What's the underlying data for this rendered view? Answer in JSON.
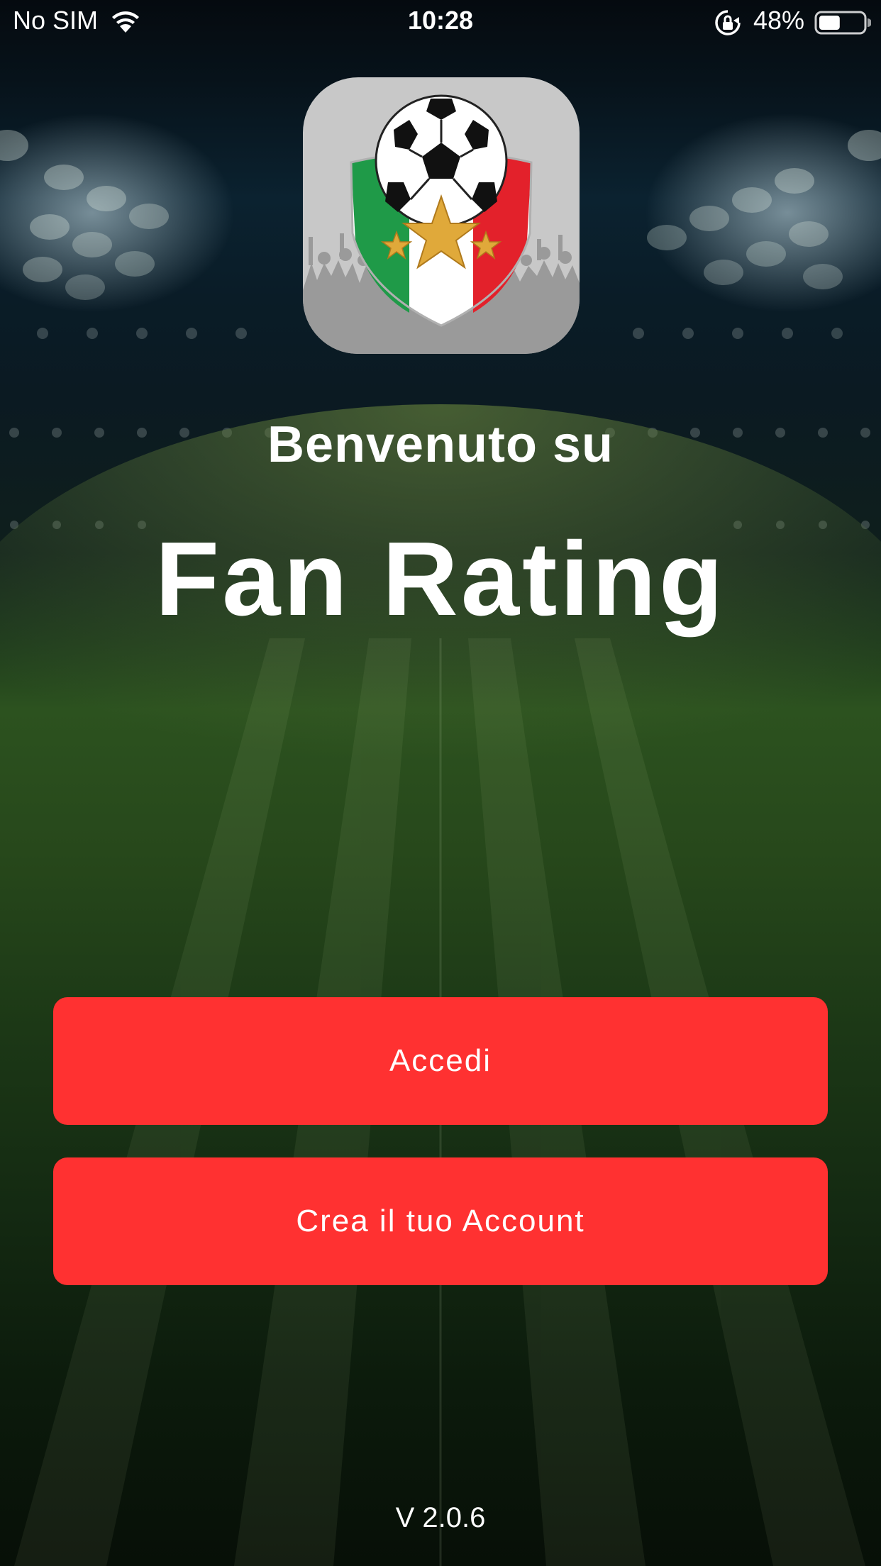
{
  "status_bar": {
    "carrier": "No SIM",
    "time": "10:28",
    "battery": "48%",
    "battery_level": 0.48,
    "icons": [
      "wifi-icon",
      "orientation-lock-icon",
      "battery-icon"
    ]
  },
  "welcome": {
    "line1": "Benvenuto su",
    "app_name": "Fan Rating"
  },
  "buttons": {
    "login": "Accedi",
    "register": "Crea il tuo Account"
  },
  "footer": {
    "version": "V 2.0.6"
  },
  "colors": {
    "button": "#ff3131",
    "text": "#ffffff",
    "icon_background": "#c8c8c8",
    "flag_green": "#1f9a48",
    "flag_white": "#ffffff",
    "flag_red": "#e3212b",
    "star_gold": "#e0a93a"
  },
  "app_icon": {
    "icons": [
      "soccer-ball-icon",
      "shield-icon",
      "star-icon"
    ]
  }
}
